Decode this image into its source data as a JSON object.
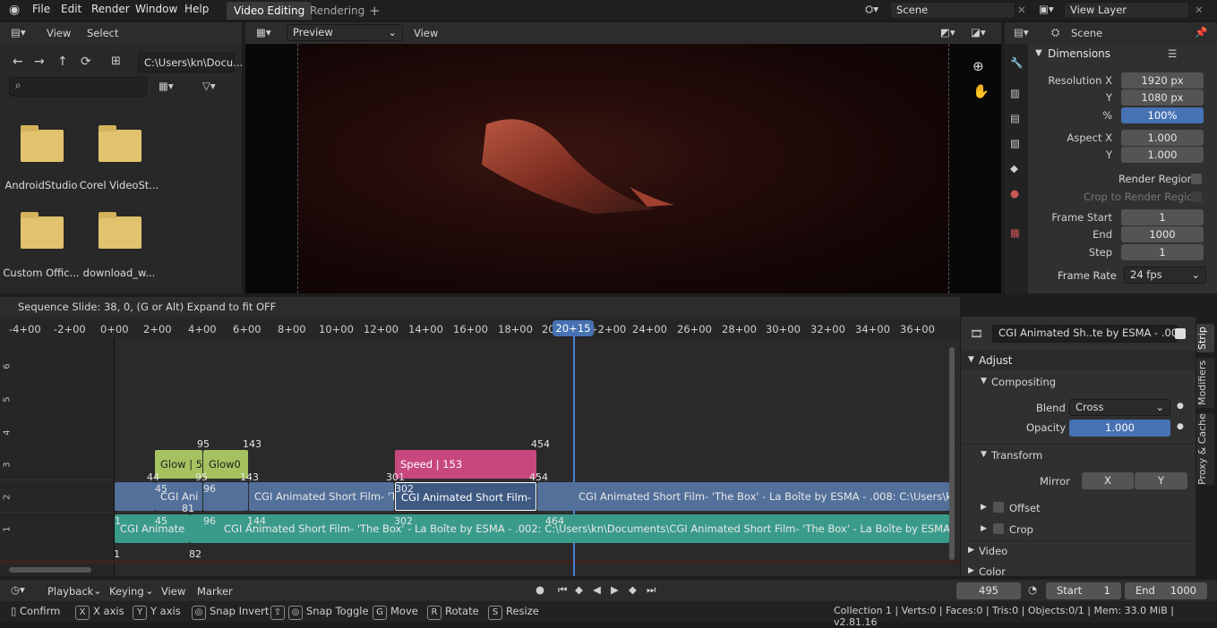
{
  "topbar": {
    "menus": [
      "File",
      "Edit",
      "Render",
      "Window",
      "Help"
    ],
    "workspace_tabs": [
      "Video Editing",
      "Rendering"
    ],
    "add_tab": "+",
    "scene": "Scene",
    "view_layer": "View Layer"
  },
  "filebrowser": {
    "header": {
      "view": "View",
      "select": "Select"
    },
    "path": "C:\\Users\\kn\\Docu...",
    "folders": [
      "AndroidStudio",
      "Corel VideoSt...",
      "Custom Offic...",
      "download_w..."
    ]
  },
  "preview": {
    "header": {
      "mode": "Preview",
      "view": "View"
    }
  },
  "properties": {
    "scene_label": "Scene",
    "panel": "Dimensions",
    "rows": [
      {
        "label": "Resolution X",
        "value": "1920 px"
      },
      {
        "label": "Y",
        "value": "1080 px"
      },
      {
        "label": "%",
        "value": "100%"
      },
      {
        "label": "Aspect X",
        "value": "1.000"
      },
      {
        "label": "Y",
        "value": "1.000"
      },
      {
        "label": "Frame Start",
        "value": "1"
      },
      {
        "label": "End",
        "value": "1000"
      },
      {
        "label": "Step",
        "value": "1"
      }
    ],
    "render_region": "Render Region",
    "crop_region": "Crop to Render Region",
    "frame_rate_label": "Frame Rate",
    "frame_rate": "24 fps"
  },
  "sequencer": {
    "status_text": "Sequence Slide: 38, 0, (G or Alt) Expand to fit OFF",
    "ticks": [
      "-4+00",
      "-2+00",
      "0+00",
      "2+00",
      "4+00",
      "6+00",
      "8+00",
      "10+00",
      "12+00",
      "14+00",
      "16+00",
      "18+00",
      "20",
      "+2+00",
      "24+00",
      "26+00",
      "28+00",
      "30+00",
      "32+00",
      "34+00",
      "36+00"
    ],
    "current_frame": "20+15",
    "channels": [
      "6",
      "5",
      "4",
      "3",
      "2",
      "1"
    ],
    "strips": {
      "glow1": "Glow | 5",
      "glow0": "Glow0",
      "speed": "Speed | 153",
      "cgi_a": "CGI Ani",
      "cgi_b": "CGI Animated Short Film- 'Th",
      "cgi_c": "CGI Animated Short Film- 'Th",
      "cgi_d": "CGI Animated Short Film- 'The Box' - La Boîte by ESMA - .008: C:\\Users\\kn\\Documents",
      "cgi_e": "CGI Animate",
      "cgi_f": "CGI Animated Short Film- 'The Box' - La Boîte by ESMA - .002: C:\\Users\\kn\\Documents\\CGI Animated Short Film- 'The Box' - La Boîte by ESMA - CGMeetup.mp4 | 1010"
    },
    "markers": [
      "95",
      "143",
      "454",
      "44",
      "95",
      "143",
      "301",
      "454",
      "45",
      "96",
      "302",
      "1",
      "45",
      "96",
      "81",
      "144",
      "302",
      "464",
      "1",
      "82"
    ]
  },
  "strip_panel": {
    "strip_name": "CGI Animated Sh..te by ESMA - .007",
    "adjust": "Adjust",
    "compositing": "Compositing",
    "blend_label": "Blend",
    "blend": "Cross",
    "opacity_label": "Opacity",
    "opacity": "1.000",
    "transform": "Transform",
    "mirror_label": "Mirror",
    "mirror_x": "X",
    "mirror_y": "Y",
    "offset": "Offset",
    "crop": "Crop",
    "video": "Video",
    "color": "Color",
    "tabs": [
      "Strip",
      "Modifiers",
      "Proxy & Cache"
    ]
  },
  "timeline": {
    "menus": [
      "Playback",
      "Keying",
      "View",
      "Marker"
    ],
    "frame": "495",
    "start_label": "Start",
    "start": "1",
    "end_label": "End",
    "end": "1000"
  },
  "statusbar": {
    "items": [
      {
        "key": "",
        "label": "Confirm"
      },
      {
        "key": "X",
        "label": "X axis"
      },
      {
        "key": "Y",
        "label": "Y axis"
      },
      {
        "key": "",
        "label": "Snap Invert"
      },
      {
        "key": "⇧",
        "label": "Snap Toggle"
      },
      {
        "key": "G",
        "label": "Move"
      },
      {
        "key": "R",
        "label": "Rotate"
      },
      {
        "key": "S",
        "label": "Resize"
      }
    ],
    "stats": "Collection 1 | Verts:0 | Faces:0 | Tris:0 | Objects:0/1 | Mem: 33.0 MiB | v2.81.16"
  }
}
